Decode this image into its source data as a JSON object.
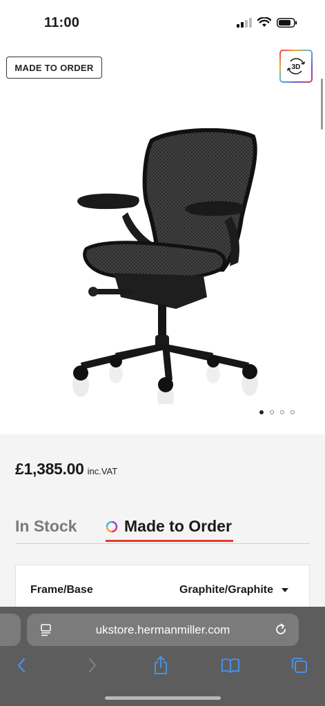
{
  "status_bar": {
    "time": "11:00"
  },
  "product": {
    "badge": "MADE TO ORDER",
    "view_3d": "3D",
    "image_alt": "Aeron office chair in graphite",
    "carousel": {
      "count": 4,
      "active": 1
    },
    "price": "£1,385.00",
    "price_note": "inc.VAT"
  },
  "tabs": [
    {
      "label": "In Stock",
      "active": false
    },
    {
      "label": "Made to Order",
      "active": true
    }
  ],
  "config": {
    "label": "Frame/Base",
    "value": "Graphite/Graphite"
  },
  "browser": {
    "url": "ukstore.hermanmiller.com",
    "icons": [
      "page-menu-icon",
      "reload-icon",
      "back-icon",
      "forward-icon",
      "share-icon",
      "bookmarks-icon",
      "tabs-icon"
    ]
  },
  "colors": {
    "accent_red": "#e23b24",
    "safari_bar": "#5d5d5d",
    "ios_blue": "#4a90e2"
  }
}
